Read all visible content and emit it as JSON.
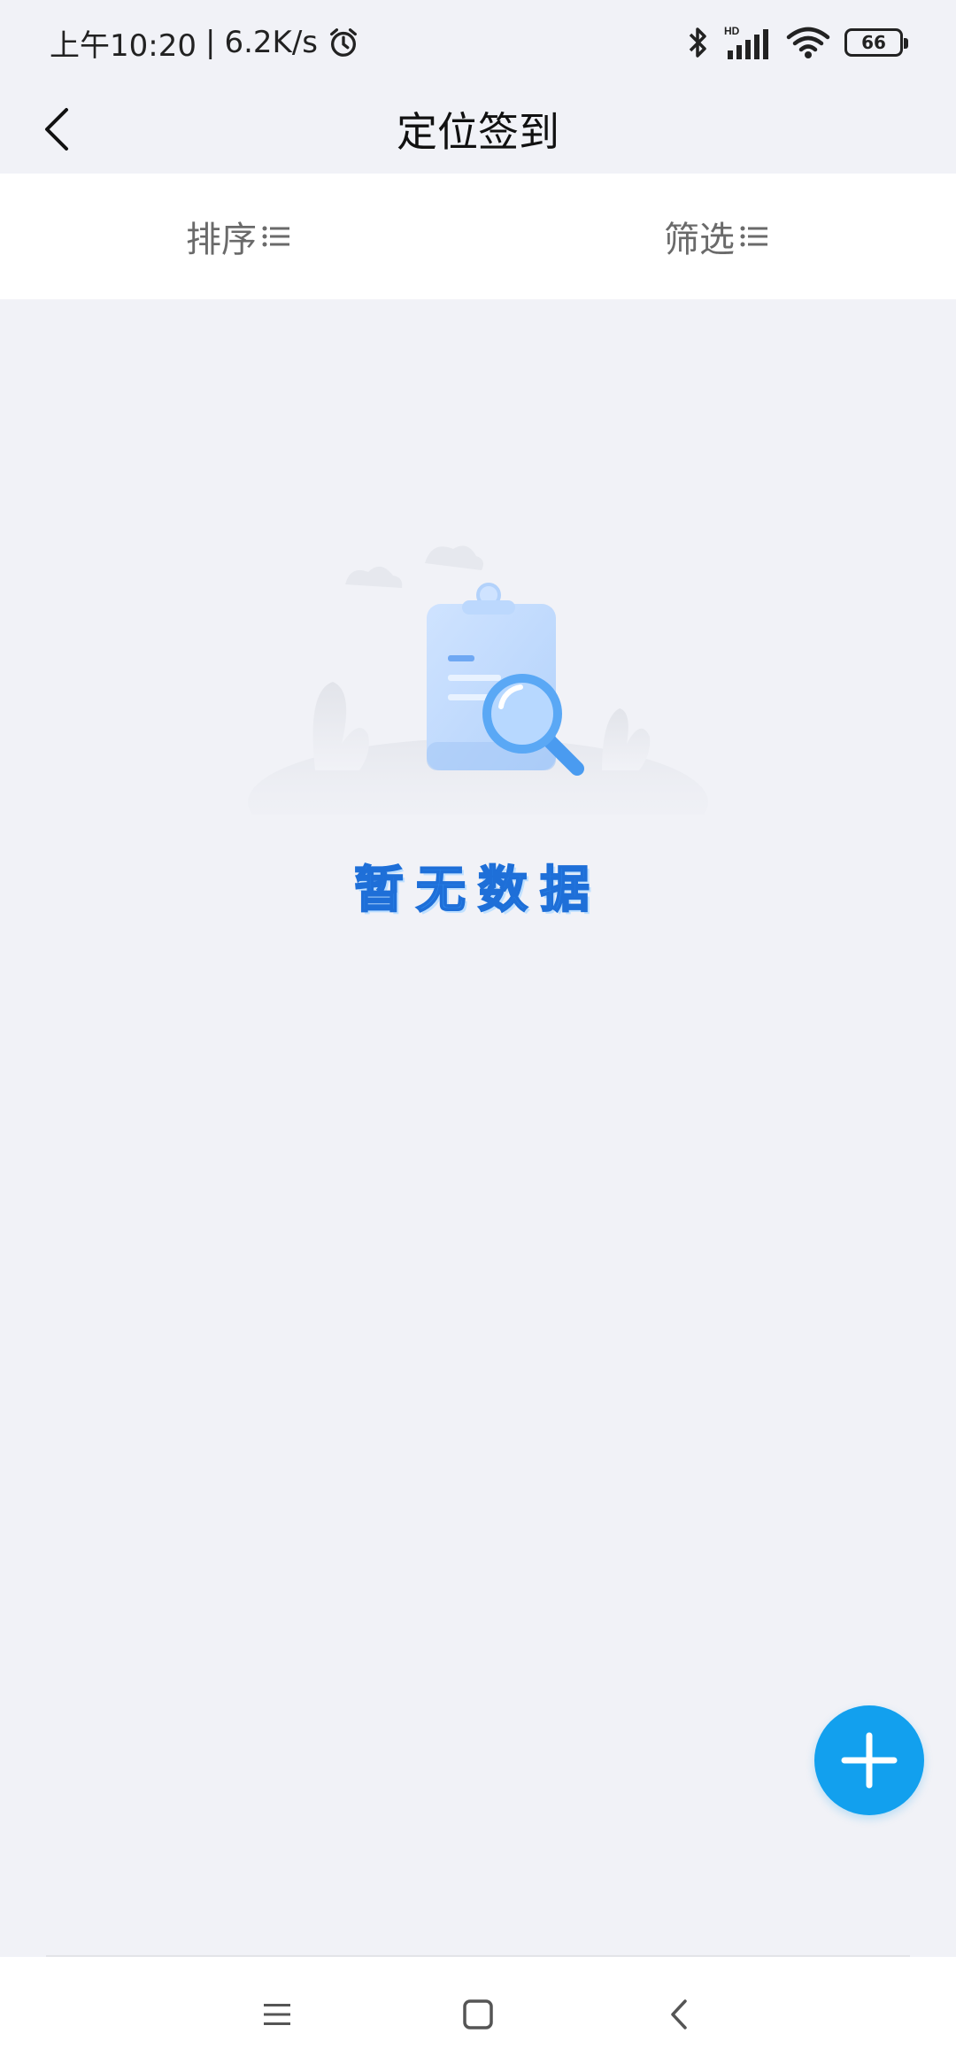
{
  "status_bar": {
    "time": "上午10:20",
    "separator": "|",
    "net_speed": "6.2K/s",
    "battery": "66",
    "icons": [
      "alarm-icon",
      "bluetooth-icon",
      "hd-signal-icon",
      "wifi-icon",
      "battery-icon"
    ]
  },
  "header": {
    "title": "定位签到",
    "back_icon": "chevron-left-icon"
  },
  "filter_bar": {
    "sort_label": "排序",
    "filter_label": "筛选",
    "icon": "list-icon"
  },
  "empty_state": {
    "message": "暂无数据",
    "illustration": "clipboard-magnifier-illustration"
  },
  "fab": {
    "icon": "plus-icon"
  },
  "nav_bar": {
    "icons": [
      "menu-icon",
      "home-icon",
      "back-icon"
    ]
  },
  "colors": {
    "background": "#f1f2f7",
    "accent": "#12a0ee",
    "empty_text": "#2f8cf0",
    "muted_text": "#6a6a6a"
  }
}
